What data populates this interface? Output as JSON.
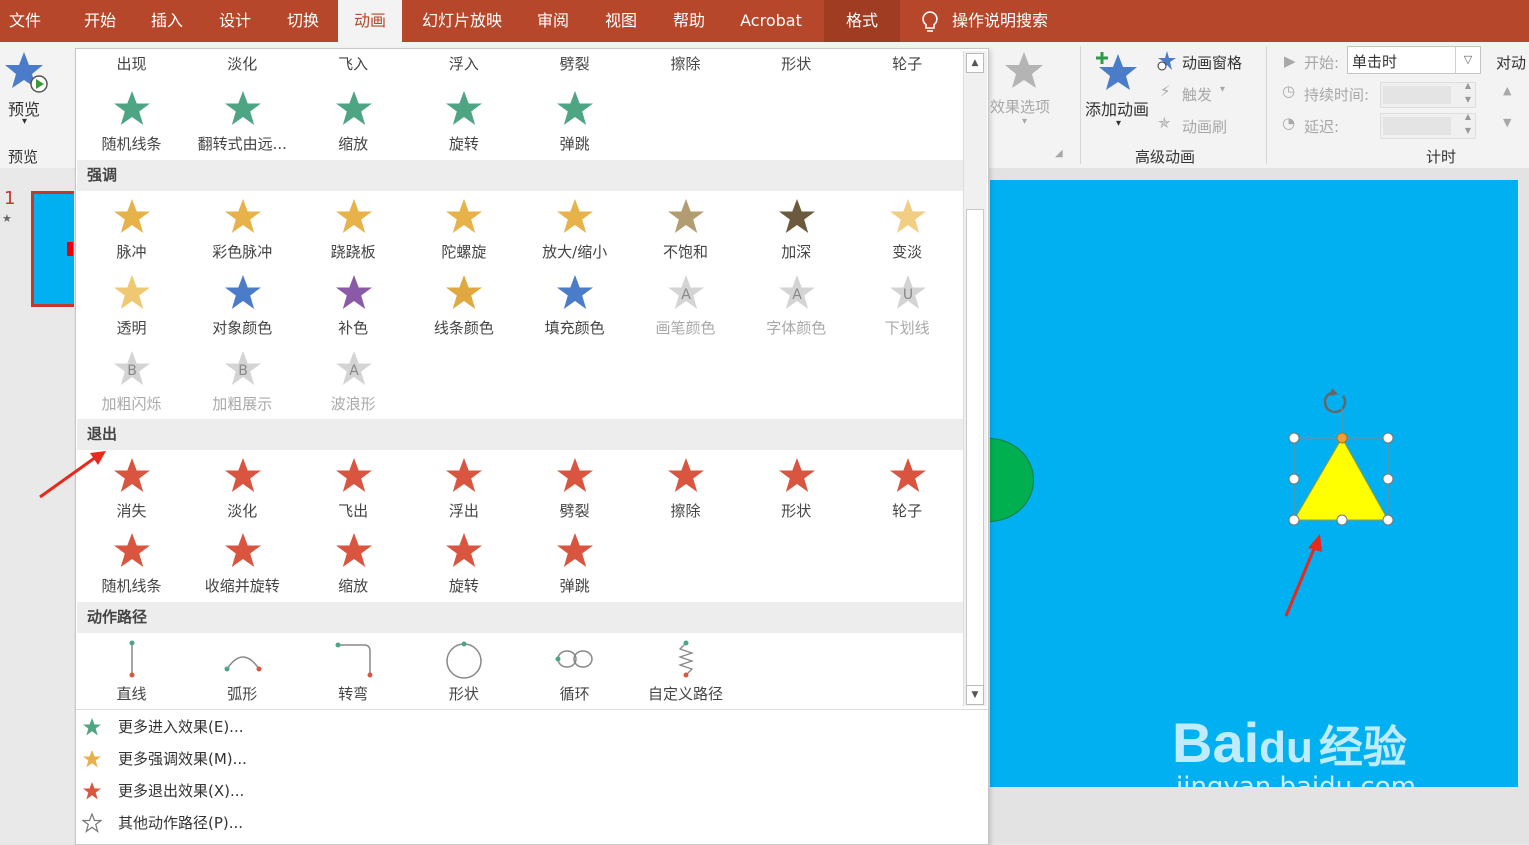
{
  "menu": {
    "tabs": [
      "文件",
      "开始",
      "插入",
      "设计",
      "切换",
      "动画",
      "幻灯片放映",
      "审阅",
      "视图",
      "帮助",
      "Acrobat",
      "格式"
    ],
    "active": "动画",
    "search": "操作说明搜索"
  },
  "ribbon": {
    "preview_button": "预览",
    "preview_group": "预览",
    "effect_options": "效果选项",
    "add_animation": "添加动画",
    "animation_pane": "动画窗格",
    "trigger": "触发",
    "animation_painter": "动画刷",
    "advanced_group": "高级动画",
    "start_label": "开始:",
    "start_value": "单击时",
    "duration_label": "持续时间:",
    "delay_label": "延迟:",
    "timing_group": "计时",
    "reorder_label": "对动"
  },
  "thumbnail": {
    "slide_number": "1",
    "anim_marker": "★"
  },
  "gallery": {
    "entrance_row1": [
      "出现",
      "淡化",
      "飞入",
      "浮入",
      "劈裂",
      "擦除",
      "形状",
      "轮子"
    ],
    "entrance_row2": [
      "随机线条",
      "翻转式由远...",
      "缩放",
      "旋转",
      "弹跳"
    ],
    "emphasis_title": "强调",
    "emphasis_row1": [
      "脉冲",
      "彩色脉冲",
      "跷跷板",
      "陀螺旋",
      "放大/缩小",
      "不饱和",
      "加深",
      "变淡"
    ],
    "emphasis_row2": [
      "透明",
      "对象颜色",
      "补色",
      "线条颜色",
      "填充颜色",
      "画笔颜色",
      "字体颜色",
      "下划线"
    ],
    "emphasis_row3": [
      "加粗闪烁",
      "加粗展示",
      "波浪形"
    ],
    "exit_title": "退出",
    "exit_row1": [
      "消失",
      "淡化",
      "飞出",
      "浮出",
      "劈裂",
      "擦除",
      "形状",
      "轮子"
    ],
    "exit_row2": [
      "随机线条",
      "收缩并旋转",
      "缩放",
      "旋转",
      "弹跳"
    ],
    "path_title": "动作路径",
    "path_row": [
      "直线",
      "弧形",
      "转弯",
      "形状",
      "循环",
      "自定义路径"
    ],
    "more": [
      "更多进入效果(E)...",
      "更多强调效果(M)...",
      "更多退出效果(X)...",
      "其他动作路径(P)..."
    ],
    "dim_glyphs": [
      "A",
      "A",
      "U",
      "B",
      "B",
      "A"
    ]
  },
  "watermark": {
    "brand": "Bai",
    "brand2": "du",
    "cn": "经验",
    "url": "jingyan.baidu.com"
  },
  "colors": {
    "accent": "#b7472a",
    "entrance": "#4ea584",
    "emphasis": "#e7b24a",
    "exit": "#d9553f",
    "slide_bg": "#00b0f0",
    "triangle": "#ffff00",
    "circle": "#00b050"
  }
}
